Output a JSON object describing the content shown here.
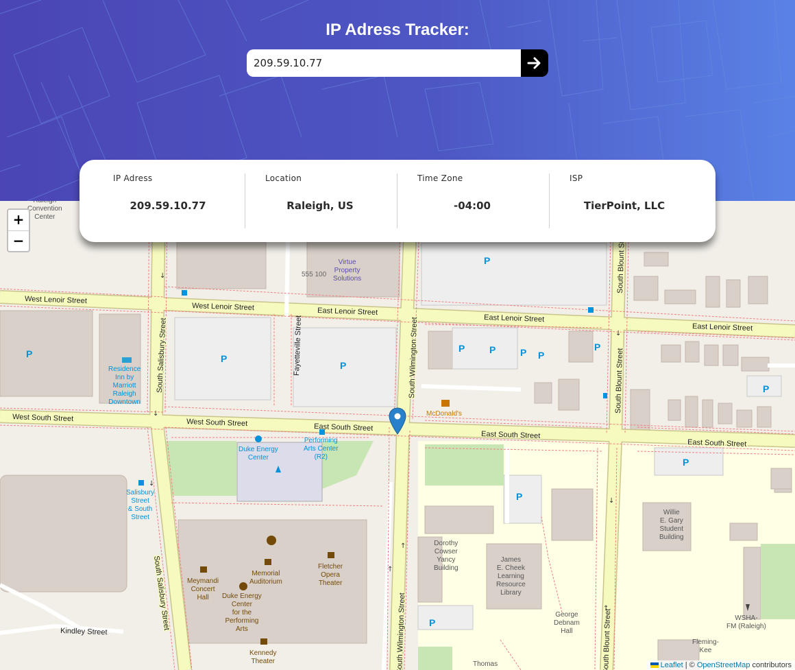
{
  "header": {
    "title": "IP Adress Tracker:",
    "search_value": "209.59.10.77",
    "submit_icon": "arrow-right-icon"
  },
  "info": [
    {
      "label": "IP Adress",
      "value": "209.59.10.77"
    },
    {
      "label": "Location",
      "value": "Raleigh, US"
    },
    {
      "label": "Time Zone",
      "value": "-04:00"
    },
    {
      "label": "ISP",
      "value": "TierPoint, LLC"
    }
  ],
  "map": {
    "zoom_in": "+",
    "zoom_out": "−",
    "attribution": {
      "leaflet": "Leaflet",
      "sep": " | © ",
      "osm": "OpenStreetMap",
      "suffix": " contributors"
    },
    "streets": {
      "w_lenoir_1": "West Lenoir Street",
      "w_lenoir_2": "West Lenoir Street",
      "e_lenoir_1": "East Lenoir Street",
      "e_lenoir_2": "East Lenoir Street",
      "e_lenoir_3": "East Lenoir Street",
      "w_south_1": "West South Street",
      "w_south_2": "West South Street",
      "e_south_1": "East South Street",
      "e_south_2": "East South Street",
      "e_south_3": "East South Street",
      "s_salisbury_1": "South Salisbury Street",
      "s_salisbury_2": "South Salisbury Street",
      "fayetteville": "Fayetteville Street",
      "s_wilmington_1": "South Wilmington Street",
      "s_wilmington_2": "South Wilmington Street",
      "s_blount_1": "South Blount Street",
      "s_blount_2": "South Blount Street",
      "s_blount_3": "South Blount Street",
      "kindley": "Kindley Street"
    },
    "places": {
      "raleigh_convention": "Raleigh\nConvention\nCenter",
      "virtue": "Virtue\nProperty\nSolutions",
      "addr_555": "555 100",
      "residence_inn": "Residence\nInn by\nMarriott\nRaleigh\nDowntown",
      "mcdonalds": "McDonald's",
      "duke_energy": "Duke Energy\nCenter",
      "pac": "Performing\nArts Center\n(R2)",
      "salisbury_stop": "Salisbury\nStreet\n& South\nStreet",
      "meymandi": "Meymandi\nConcert\nHall",
      "memorial": "Memorial\nAuditorium",
      "fletcher": "Fletcher\nOpera\nTheater",
      "dukecenter_pa": "Duke Energy\nCenter\nfor the\nPerforming\nArts",
      "kennedy": "Kennedy\nTheater",
      "dorothy": "Dorothy\nCowser\nYancy\nBuilding",
      "cheek": "James\nE. Cheek\nLearning\nResource\nLibrary",
      "debnam": "George\nDebnam\nHall",
      "gary": "Willie\nE. Gary\nStudent\nBuilding",
      "wsha": "WSHA-\nFM (Raleigh)",
      "fleming": "Fleming-\nKee",
      "thomas": "Thomas",
      "parking": "P"
    }
  }
}
